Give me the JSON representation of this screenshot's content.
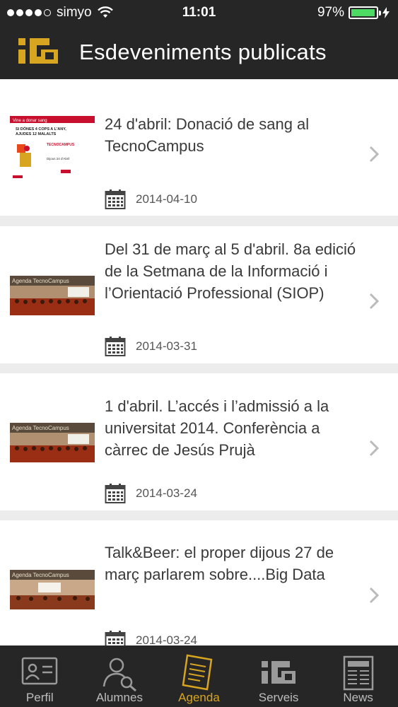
{
  "status_bar": {
    "carrier": "simyo",
    "time": "11:01",
    "battery": "97%",
    "battery_level": 0.97
  },
  "nav": {
    "title": "Esdeveniments publicats",
    "logo_icon": "tecnocampus-logo-icon"
  },
  "events": [
    {
      "title": "24 d'abril: Donació de sang al TecnoCampus",
      "date": "2014-04-10",
      "thumb": {
        "header": "Vine a donar sang",
        "line1": "SI DÓNES 4 COPS A L'ANY,",
        "line2": "AJUDES 12 MALALTS",
        "place": "TECNOCAMPUS",
        "day": "Dijous 24 d'Abril"
      }
    },
    {
      "title": "Del 31 de març al 5 d'abril. 8a edició de la Setmana de la Informació i l’Orientació Professional (SIOP)",
      "date": "2014-03-31",
      "thumb": {
        "header": "Agenda TecnoCampus"
      }
    },
    {
      "title": "1 d'abril. L’accés i l’admissió a la universitat 2014. Conferència a càrrec de Jesús Prujà",
      "date": "2014-03-24",
      "thumb": {
        "header": "Agenda TecnoCampus"
      }
    },
    {
      "title": "Talk&Beer: el proper dijous 27 de març parlarem sobre....Big Data",
      "date": "2014-03-24",
      "thumb": {
        "header": "Agenda TecnoCampus"
      }
    }
  ],
  "tabs": [
    {
      "label": "Perfil",
      "icon": "profile-card-icon",
      "active": false
    },
    {
      "label": "Alumnes",
      "icon": "user-search-icon",
      "active": false
    },
    {
      "label": "Agenda",
      "icon": "agenda-scroll-icon",
      "active": true
    },
    {
      "label": "Serveis",
      "icon": "services-logo-icon",
      "active": false
    },
    {
      "label": "News",
      "icon": "newspaper-icon",
      "active": false
    }
  ],
  "colors": {
    "bar_background": "#262626",
    "accent": "#d8a521",
    "battery": "#4cd964"
  }
}
